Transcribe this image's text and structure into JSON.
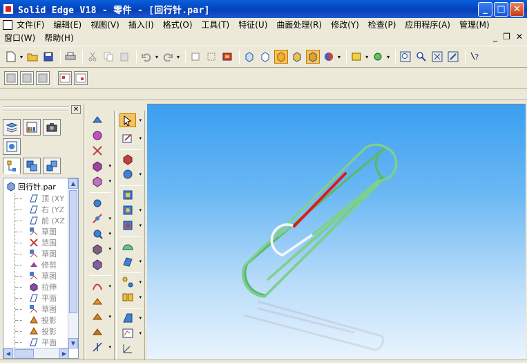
{
  "window": {
    "title": "Solid Edge V18 - 零件 - [回行针.par]",
    "minimize_label": "_",
    "maximize_label": "□",
    "close_label": "✕"
  },
  "menu": {
    "row1": [
      "文件(F)",
      "编辑(E)",
      "视图(V)",
      "插入(I)",
      "格式(O)",
      "工具(T)",
      "特征(U)",
      "曲面处理(R)",
      "修改(Y)",
      "检查(P)",
      "应用程序(A)",
      "管理(M)"
    ],
    "row2": [
      "窗口(W)",
      "帮助(H)"
    ],
    "mdi_minimize": "_",
    "mdi_restore": "❐",
    "mdi_close": "✕"
  },
  "tree": {
    "root": "回行针.par",
    "items": [
      {
        "label": "顶 (XY",
        "icon": "plane-icon",
        "dim": true
      },
      {
        "label": "右 (YZ",
        "icon": "plane-icon",
        "dim": true
      },
      {
        "label": "前 (XZ",
        "icon": "plane-icon",
        "dim": true
      },
      {
        "label": "草图",
        "icon": "sketch-icon",
        "dim": true
      },
      {
        "label": "范围",
        "icon": "range-icon",
        "dim": true
      },
      {
        "label": "草图",
        "icon": "sketch-icon",
        "dim": true
      },
      {
        "label": "修剪",
        "icon": "trim-icon",
        "dim": true
      },
      {
        "label": "草图",
        "icon": "sketch-icon",
        "dim": true
      },
      {
        "label": "拉伸",
        "icon": "extrude-icon",
        "dim": true
      },
      {
        "label": "平面",
        "icon": "plane-icon",
        "dim": true
      },
      {
        "label": "草图",
        "icon": "sketch-icon",
        "dim": true
      },
      {
        "label": "投影",
        "icon": "project-icon",
        "dim": true
      },
      {
        "label": "投影",
        "icon": "project-icon",
        "dim": true
      },
      {
        "label": "平面",
        "icon": "plane-icon",
        "dim": true
      }
    ]
  },
  "colors": {
    "clip_wire": "#7fd08a",
    "highlight_red": "#e01818",
    "highlight_white": "#f4f6fa",
    "viewport_top": "#3a9ff0",
    "viewport_bottom": "#eaf4fe"
  }
}
